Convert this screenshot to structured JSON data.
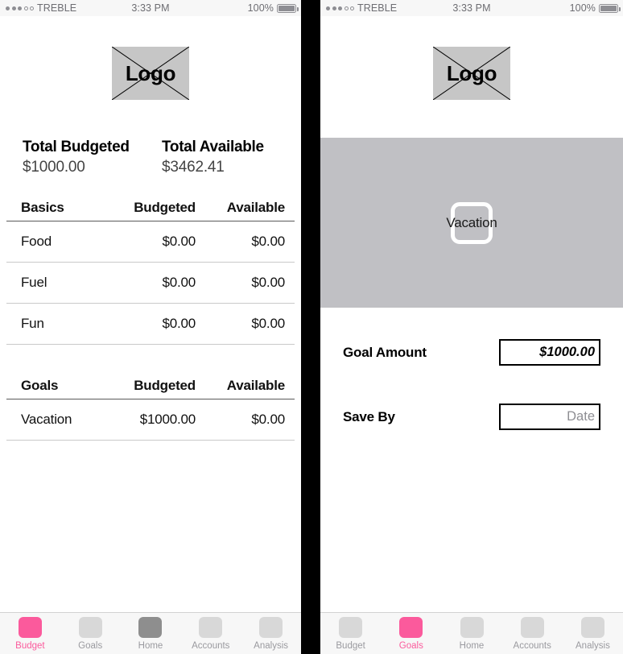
{
  "status_bar": {
    "carrier": "TREBLE",
    "time": "3:33 PM",
    "battery": "100%",
    "signal_dots_filled": 3,
    "signal_dots_empty": 2
  },
  "logo": {
    "text": "Logo"
  },
  "left_screen": {
    "totals": [
      {
        "label": "Total Budgeted",
        "value": "$1000.00"
      },
      {
        "label": "Total Available",
        "value": "$3462.41"
      }
    ],
    "basics_header": {
      "name": "Basics",
      "budgeted": "Budgeted",
      "available": "Available"
    },
    "basics_rows": [
      {
        "name": "Food",
        "budgeted": "$0.00",
        "available": "$0.00"
      },
      {
        "name": "Fuel",
        "budgeted": "$0.00",
        "available": "$0.00"
      },
      {
        "name": "Fun",
        "budgeted": "$0.00",
        "available": "$0.00"
      }
    ],
    "goals_header": {
      "name": "Goals",
      "budgeted": "Budgeted",
      "available": "Available"
    },
    "goals_rows": [
      {
        "name": "Vacation",
        "budgeted": "$1000.00",
        "available": "$0.00"
      }
    ]
  },
  "right_screen": {
    "banner": {
      "label": "Vacation",
      "background_color": "#c0c0c4"
    },
    "fields": [
      {
        "label": "Goal Amount",
        "value": "$1000.00",
        "placeholder": ""
      },
      {
        "label": "Save By",
        "value": "",
        "placeholder": "Date"
      }
    ]
  },
  "tabbar_left": {
    "items": [
      {
        "label": "Budget",
        "state": "active"
      },
      {
        "label": "Goals",
        "state": "inactive"
      },
      {
        "label": "Home",
        "state": "dark"
      },
      {
        "label": "Accounts",
        "state": "inactive"
      },
      {
        "label": "Analysis",
        "state": "inactive"
      }
    ]
  },
  "tabbar_right": {
    "items": [
      {
        "label": "Budget",
        "state": "inactive"
      },
      {
        "label": "Goals",
        "state": "active"
      },
      {
        "label": "Home",
        "state": "inactive"
      },
      {
        "label": "Accounts",
        "state": "inactive"
      },
      {
        "label": "Analysis",
        "state": "inactive"
      }
    ]
  },
  "colors": {
    "accent_pink": "#fb5a9c",
    "banner_gray": "#c0c0c4",
    "tab_gray": "#d8d8d8"
  }
}
